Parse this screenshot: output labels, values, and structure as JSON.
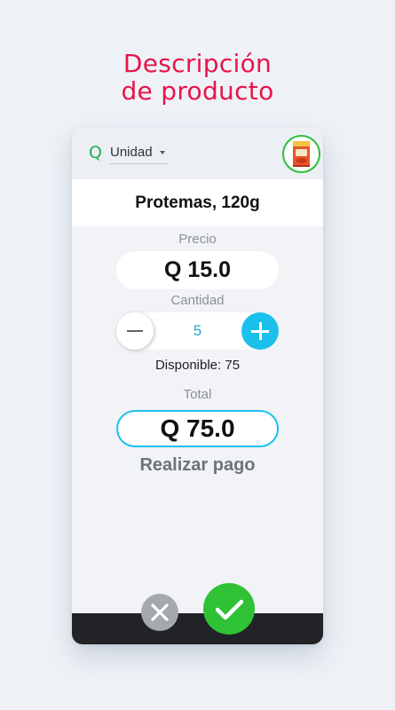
{
  "headline": {
    "line1": "Descripción",
    "line2": "de producto"
  },
  "header": {
    "currency_symbol": "Q",
    "unit_select": {
      "selected": "Unidad"
    },
    "product_image_icon": "product-snack-bag-icon"
  },
  "product": {
    "name": "Protemas, 120g"
  },
  "price": {
    "label": "Precio",
    "value": "Q 15.0"
  },
  "quantity": {
    "label": "Cantidad",
    "value": "5",
    "decrement_icon": "minus-icon",
    "increment_icon": "plus-icon"
  },
  "availability": {
    "text": "Disponible: 75"
  },
  "total": {
    "label": "Total",
    "value": "Q 75.0"
  },
  "pay": {
    "label": "Realizar pago"
  },
  "actions": {
    "cancel_icon": "close-icon",
    "confirm_icon": "check-icon"
  },
  "colors": {
    "headline": "#e8134a",
    "currency": "#22b14c",
    "accent_cyan": "#1cc0ec",
    "confirm_green": "#2fc136",
    "cancel_gray": "#a5a9ad",
    "bottom_bar": "#212327"
  }
}
